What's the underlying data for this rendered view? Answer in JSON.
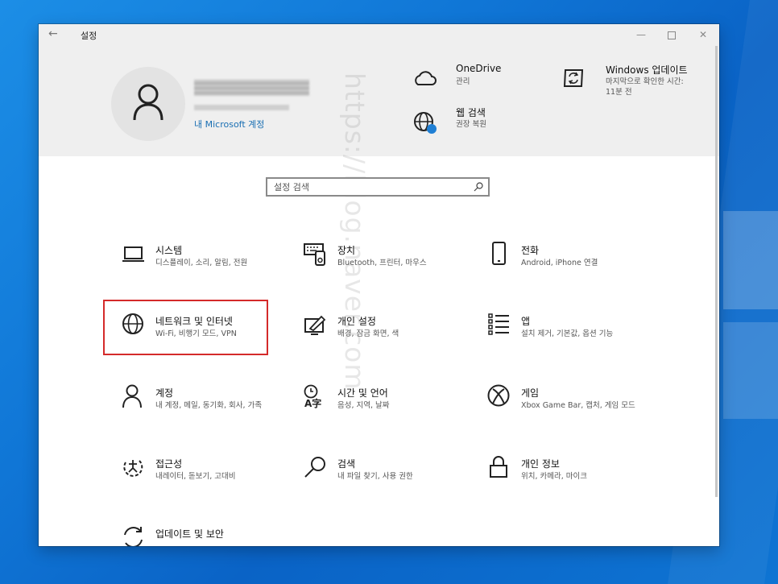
{
  "window": {
    "title": "설정",
    "back_glyph": "←",
    "minimize_glyph": "—",
    "close_glyph": "✕"
  },
  "account": {
    "link": "내 Microsoft 계정"
  },
  "header_items": [
    {
      "title": "OneDrive",
      "subtitle": "관리",
      "icon": "cloud-icon"
    },
    {
      "title": "웹 검색",
      "subtitle": "권장 복원",
      "icon": "globe-icon"
    },
    {
      "title": "Windows 업데이트",
      "subtitle": "마지막으로 확인한 시간: 11분 전",
      "icon": "update-icon"
    }
  ],
  "search": {
    "placeholder": "설정 검색",
    "icon": "search-icon"
  },
  "watermark": "https://blog.naver.com",
  "tiles": [
    {
      "title": "시스템",
      "subtitle": "디스플레이, 소리, 알림, 전원",
      "icon": "laptop-icon"
    },
    {
      "title": "장치",
      "subtitle": "Bluetooth, 프린터, 마우스",
      "icon": "devices-icon"
    },
    {
      "title": "전화",
      "subtitle": "Android, iPhone 연결",
      "icon": "phone-icon"
    },
    {
      "title": "네트워크 및 인터넷",
      "subtitle": "Wi-Fi, 비행기 모드, VPN",
      "icon": "globe-icon"
    },
    {
      "title": "개인 설정",
      "subtitle": "배경, 잠금 화면, 색",
      "icon": "personalization-icon"
    },
    {
      "title": "앱",
      "subtitle": "설치 제거, 기본값, 옵션 기능",
      "icon": "apps-list-icon"
    },
    {
      "title": "계정",
      "subtitle": "내 계정, 메일, 동기화, 회사, 가족",
      "icon": "person-icon"
    },
    {
      "title": "시간 및 언어",
      "subtitle": "음성, 지역, 날짜",
      "icon": "time-language-icon"
    },
    {
      "title": "게임",
      "subtitle": "Xbox Game Bar, 캡처, 게임 모드",
      "icon": "xbox-icon"
    },
    {
      "title": "접근성",
      "subtitle": "내레이터, 돋보기, 고대비",
      "icon": "accessibility-icon"
    },
    {
      "title": "검색",
      "subtitle": "내 파일 찾기, 사용 권한",
      "icon": "search-icon"
    },
    {
      "title": "개인 정보",
      "subtitle": "위치, 카메라, 마이크",
      "icon": "lock-icon"
    },
    {
      "title": "업데이트 및 보안",
      "subtitle": "",
      "icon": "refresh-icon"
    }
  ],
  "highlighted_tile": "네트워크 및 인터넷",
  "colors": {
    "accent": "#1a6fb3",
    "highlight_border": "#d42a2a",
    "header_bg": "#efefef",
    "desktop": "#0f6fd0"
  }
}
